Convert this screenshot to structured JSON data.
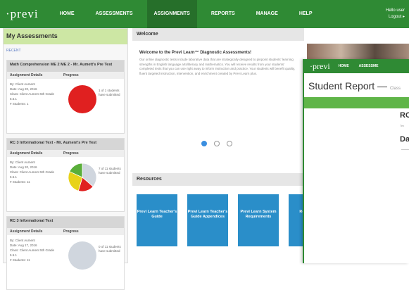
{
  "nav": {
    "logo": "·previ",
    "items": [
      "HOME",
      "ASSESSMENTS",
      "ASSIGNMENTS",
      "REPORTS",
      "MANAGE",
      "HELP"
    ],
    "active_index": 2,
    "user_greeting": "Hello user",
    "logout": "Logout ▸"
  },
  "left_panel": {
    "title": "My Assessments",
    "section": "RECENT",
    "cards": [
      {
        "title": "Math Comprehension ME 2 ME 2 - Mr. Aumett's Pre Test",
        "col_details": "Assignment Details",
        "col_progress": "Progress",
        "meta": [
          "By: Client Aument",
          "Date: Aug 20, 2016",
          "Class: Client Aument 5th Grade 5.5.1",
          "# Students: 1"
        ],
        "status": "1 of 1 students have submitted",
        "slices": [
          {
            "color": "#e02020",
            "value": 1
          }
        ]
      },
      {
        "title": "RC 3 Informational Text - Mr. Aument's Pre Test",
        "col_details": "Assignment Details",
        "col_progress": "Progress",
        "meta": [
          "By: Client Aument",
          "Date: Aug 20, 2016",
          "Class: Client Aument 5th Grade 5.5.1",
          "# Students: 11"
        ],
        "status": "7 of 11 students have submitted",
        "slices": [
          {
            "color": "#d0d6de",
            "value": 4
          },
          {
            "color": "#e02020",
            "value": 2
          },
          {
            "color": "#e8d21a",
            "value": 3
          },
          {
            "color": "#5aae3a",
            "value": 2
          }
        ]
      },
      {
        "title": "RC 3 Informational Text",
        "col_details": "Assignment Details",
        "col_progress": "Progress",
        "meta": [
          "By: Client Aument",
          "Date: Aug 17, 2016",
          "Class: Client Aument 5th Grade 5.5.1",
          "# Students: 11"
        ],
        "status": "0 of 11 students have submitted",
        "slices": [
          {
            "color": "#d0d6de",
            "value": 1
          }
        ]
      }
    ]
  },
  "welcome": {
    "header": "Welcome",
    "title": "Welcome to the Previ Learn™ Diagnostic Assessments!",
    "body": "Our online diagnostic tests include laborative data that are strategically designed to pinpoint students' learning strengths in English language arts/literacy and mathematics. You will receive results from your students' completed tests that you can use right away to inform instruction and practice. Your students will benefit quality, fluent targeted instruction, intervention, and enrichment created by Previ Learn plus."
  },
  "resources": {
    "header": "Resources",
    "tiles": [
      "Previ Learn Teacher's Guide",
      "Previ Learn Teacher's Guide Appendices",
      "Previ Learn System Requirements",
      "Reso Hom"
    ]
  },
  "overlay": {
    "logo": "·previ",
    "nav": [
      "HOME",
      "ASSESSME"
    ],
    "title": "Student Report —",
    "subtitle": "Class",
    "r1": "RC",
    "r2": "Tex",
    "r3": "Da"
  }
}
